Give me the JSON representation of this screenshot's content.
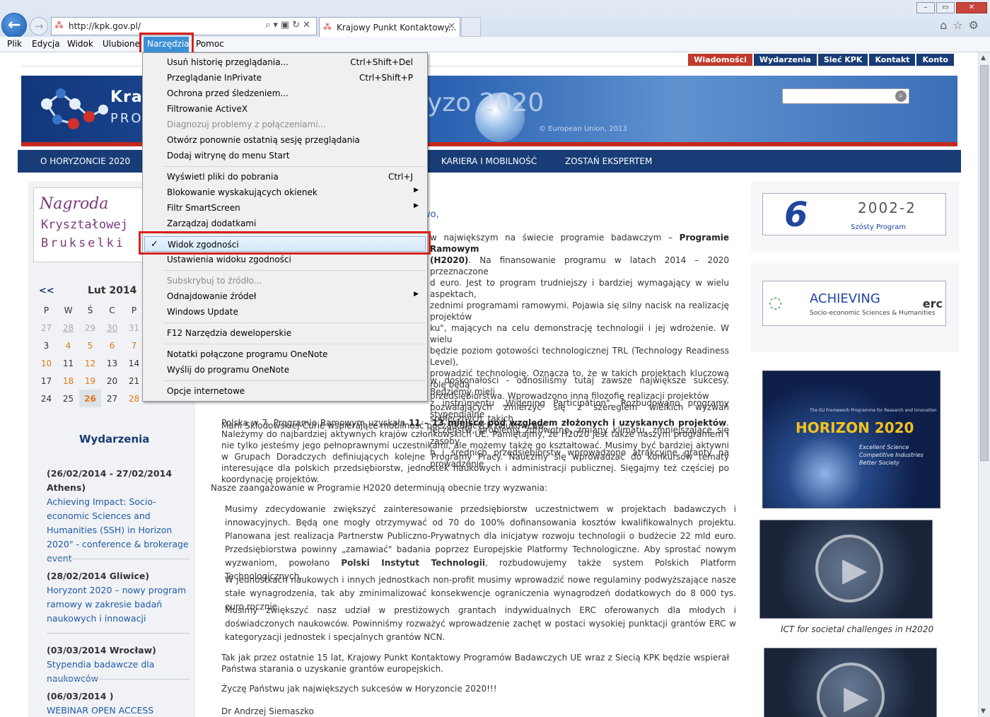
{
  "browser": {
    "url": "http://kpk.gov.pl/",
    "tab_title": "Krajowy Punkt Kontaktowy...",
    "window_buttons": [
      "–",
      "▭",
      "✕"
    ]
  },
  "menubar": [
    "Plik",
    "Edycja",
    "Widok",
    "Ulubione",
    "Narzędzia",
    "Pomoc"
  ],
  "tools_menu": {
    "items": [
      {
        "label": "Usuń historię przeglądania...",
        "shortcut": "Ctrl+Shift+Del"
      },
      {
        "label": "Przeglądanie InPrivate",
        "shortcut": "Ctrl+Shift+P"
      },
      {
        "label": "Ochrona przed śledzeniem..."
      },
      {
        "label": "Filtrowanie ActiveX"
      },
      {
        "label": "Diagnozuj problemy z połączeniami...",
        "disabled": true
      },
      {
        "label": "Otwórz ponownie ostatnią sesję przeglądania"
      },
      {
        "label": "Dodaj witrynę do menu Start"
      },
      {
        "label": "Wyświetl pliki do pobrania",
        "shortcut": "Ctrl+J"
      },
      {
        "label": "Blokowanie wyskakujących okienek"
      },
      {
        "label": "Filtr SmartScreen"
      },
      {
        "label": "Zarządzaj dodatkami"
      },
      {
        "label": "Widok zgodności",
        "checked": "✓"
      },
      {
        "label": "Ustawienia widoku zgodności"
      },
      {
        "label": "Subskrybuj to źródło...",
        "disabled": true
      },
      {
        "label": "Odnajdowanie źródeł"
      },
      {
        "label": "Windows Update"
      },
      {
        "label": "F12 Narzędzia deweloperskie"
      },
      {
        "label": "Notatki połączone programu OneNote"
      },
      {
        "label": "Wyślij do programu OneNote"
      },
      {
        "label": "Opcje internetowe"
      }
    ]
  },
  "site": {
    "top_links": [
      "Wiadomości",
      "Wydarzenia",
      "Sieć KPK",
      "Kontakt",
      "Konto"
    ],
    "brand_line1": "Kraj",
    "brand_line2": "PROG",
    "banner_h2020": "yzo 2020",
    "banner_copyright": "© European Union, 2013",
    "nav": [
      "O HORYZONCIE 2020",
      "KARIERA I MOBILNOŚĆ",
      "ZOSTAŃ EKSPERTEM"
    ],
    "award": {
      "line1": "Nagroda",
      "line2": "Kryształowej",
      "line3": "Brukselki"
    },
    "calendar": {
      "prev": "<<",
      "month": "Lut 2014",
      "weekdays": [
        "P",
        "W",
        "Ś",
        "C",
        "P"
      ],
      "rows": [
        [
          "27",
          "28",
          "29",
          "30",
          "31"
        ],
        [
          "3",
          "4",
          "5",
          "6",
          "7"
        ],
        [
          "10",
          "11",
          "12",
          "13",
          "14"
        ],
        [
          "17",
          "18",
          "19",
          "20",
          "21"
        ],
        [
          "24",
          "25",
          "26",
          "27",
          "28"
        ]
      ]
    },
    "events_title": "Wydarzenia",
    "events": [
      {
        "date": "(26/02/2014 - 27/02/2014 Athens)",
        "title": "Achieving Impact: Socio-economic Sciences and Humanities (SSH) in Horizon 2020\" - conference & brokerage event"
      },
      {
        "date": "(28/02/2014 Gliwice)",
        "title": "Horyzont 2020 – nowy program ramowy w zakresie badań naukowych i innowacji"
      },
      {
        "date": "(03/03/2014 Wrocław)",
        "title": "Stypendia badawcze dla naukowców"
      },
      {
        "date": "(06/03/2014 )",
        "title": "WEBINAR OPEN ACCESS"
      }
    ],
    "greeting": "wo,",
    "p1_pre": "w największym na świecie programie badawczym – ",
    "p1_bold": "Programie Ramowym",
    "p1_bold2": "(H2020)",
    "p1_lines": [
      ". Na finansowanie programu w latach 2014 – 2020 przeznaczone",
      "d euro. Jest to program trudniejszy i bardziej wymagający w wielu aspektach,",
      "zednimi programami ramowymi. Pojawia się silny nacisk na realizację projektów",
      "ku\", mających na celu demonstrację technologii i jej wdrożenie. W wielu",
      "będzie poziom gotowości technologicznej TRL (Technology Readiness Level),",
      "prowadzić technologię. Oznacza to, że w takich projektach kluczową rolę będą",
      "przedsiębiorstwa. Wprowadzono inną filozofię realizacji projektów",
      "pozwalających zmierzyć się z szeregiem wielkich wyzwań społecznych, takich",
      "łeczeństw, problemy zdrowotne, zmiany klimatu, zmniejszające się zasoby",
      "h i średnich przedsiębiorstw wprowadzono atrakcyjne granty na prowadzenie"
    ],
    "p2_lines": [
      "w doskonałości - odnosiliśmy tutaj zawsze największe sukcesy. Będziemy mieli",
      "z instrumentu „Widening Participation\". Rozbudowano programy stypendialne",
      "Marii Skłodowskiej-Curie wspierające mobilność początkujących naukowców."
    ],
    "p3_pre": "Polska w 7. Programie Ramowym uzyskała ",
    "p3_bold": "11 – 13 miejsce pod względem złożonych i uzyskanych projektów",
    "p3_rest": ". Należymy do najbardziej aktywnych krajów członkowskich UE. Pamiętajmy, że H2020 jest także naszym programem i nie tylko jesteśmy jego pełnoprawnymi uczestnikami, ale możemy także go kształtować. Musimy być bardziej aktywni w Grupach Doradczych definiujących kolejne Programy Pracy. Nauczmy się wprowadzać do konkursów tematy interesujące dla polskich przedsiębiorstw, jednostek naukowych i administracji publicznej. Sięgajmy też częściej po koordynację projektów.",
    "p4": "Nasze zaangażowanie w Programie H2020 determinują obecnie trzy wyzwania:",
    "b1_pre": "Musimy zdecydowanie zwiększyć zainteresowanie przedsiębiorstw uczestnictwem w projektach badawczych i innowacyjnych. Będą one mogły otrzymywać od 70 do 100% dofinansowania kosztów kwalifikowalnych projektu. Planowana jest realizacja Partnerstw Publiczno-Prywatnych dla inicjatyw rozwoju technologii o budżecie 22 mld euro. Przedsiębiorstwa powinny „zamawiać\" badania poprzez Europejskie Platformy Technologiczne. Aby sprostać nowym wyzwaniom, powołano ",
    "b1_bold": "Polski Instytut Technologii",
    "b1_rest": ", rozbudowujemy także system Polskich Platform Technologicznych.",
    "b2": "W jednostkach naukowych i innych jednostkach non-profit musimy wprowadzić nowe regulaminy podwyższające nasze stałe wynagrodzenia, tak aby zminimalizować konsekwencje ograniczenia wynagrodzeń dodatkowych do 8 000 tys. euro rocznie.",
    "b3": "Musimy zwiększyć nasz udział w prestiżowych grantach indywidualnych ERC oferowanych dla młodych i doświadczonych naukowców. Powinniśmy rozważyć wprowadzenie zachęt w postaci wysokiej punktacji grantów ERC w kategoryzacji jednostek i specjalnych grantów NCN.",
    "p5": "Tak jak przez ostatnie 15 lat, Krajowy Punkt Kontaktowy Programów Badawczych UE wraz z Siecią KPK będzie wspierał Państwa starania o uzyskanie grantów europejskich.",
    "p6": "Życzę Państwu jak największych sukcesów w Horyzoncie 2020!!!",
    "signature": "Dr Andrzej Siemaszko",
    "right": {
      "fp6_years": "2002-2",
      "fp6_sub": "Szósty Program",
      "ach_title": "ACHIEVING",
      "ach_sub": "Socio-economic Sciences & Humanities",
      "ach_erc": "erc",
      "h2020_program": "The EU Framework Programme for Research and Innovation",
      "h2020_title": "HORIZON 2020",
      "h2020_sub1": "Excellent Science",
      "h2020_sub2": "Competitive Industries",
      "h2020_sub3": "Better Society",
      "video_caption": "ICT for societal challenges in H2020"
    }
  }
}
